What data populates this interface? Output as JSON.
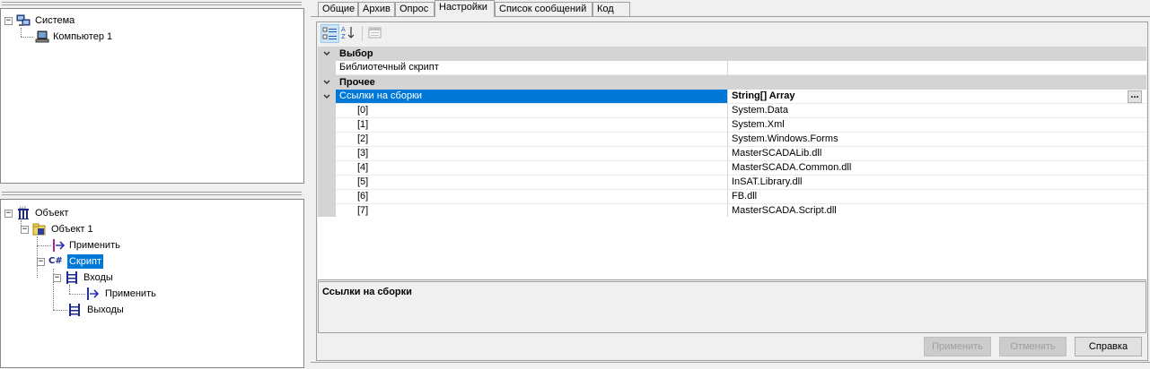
{
  "top_tree": {
    "root": {
      "label": "Система",
      "expander": "⊟",
      "icon": "system-computers-icon"
    },
    "child": {
      "label": "Компьютер 1",
      "icon": "computer-icon"
    }
  },
  "bottom_tree": {
    "root": {
      "label": "Объект",
      "expander": "⊟",
      "icon": "object-icon"
    },
    "object1": {
      "label": "Объект 1",
      "expander": "⊟",
      "icon": "folder-object-icon"
    },
    "apply1": {
      "label": "Применить",
      "icon": "apply-event-icon"
    },
    "script": {
      "label": "Скрипт",
      "expander": "⊟",
      "icon": "csharp-icon",
      "icon_text": "C#"
    },
    "inputs": {
      "label": "Входы",
      "expander": "⊟",
      "icon": "inputs-icon"
    },
    "apply2": {
      "label": "Применить",
      "icon": "apply-event-icon"
    },
    "outputs": {
      "label": "Выходы",
      "icon": "outputs-icon"
    }
  },
  "tabs": [
    {
      "label": "Общие"
    },
    {
      "label": "Архив"
    },
    {
      "label": "Опрос"
    },
    {
      "label": "Настройки",
      "active": true
    },
    {
      "label": "Список сообщений"
    },
    {
      "label": "Код"
    }
  ],
  "toolbar": {
    "categorized": "categorized-view-icon",
    "alphabetical": "sort-alphabetical-icon",
    "property_pages": "property-pages-icon"
  },
  "grid": {
    "category1": "Выбор",
    "prop_library_script": {
      "name": "Библиотечный скрипт",
      "value": ""
    },
    "category2": "Прочее",
    "prop_refs": {
      "name": "Ссылки на сборки",
      "value": "String[] Array",
      "button": "..."
    },
    "items": [
      {
        "name": "[0]",
        "value": "System.Data"
      },
      {
        "name": "[1]",
        "value": "System.Xml"
      },
      {
        "name": "[2]",
        "value": "System.Windows.Forms"
      },
      {
        "name": "[3]",
        "value": "MasterSCADALib.dll"
      },
      {
        "name": "[4]",
        "value": "MasterSCADA.Common.dll"
      },
      {
        "name": "[5]",
        "value": "InSAT.Library.dll"
      },
      {
        "name": "[6]",
        "value": "FB.dll"
      },
      {
        "name": "[7]",
        "value": "MasterSCADA.Script.dll"
      }
    ]
  },
  "description": {
    "title": "Ссылки на сборки"
  },
  "buttons": {
    "apply": "Применить",
    "cancel": "Отменить",
    "help": "Справка"
  },
  "colors": {
    "selection": "#0078d7",
    "category_band": "#d4d4d4"
  }
}
